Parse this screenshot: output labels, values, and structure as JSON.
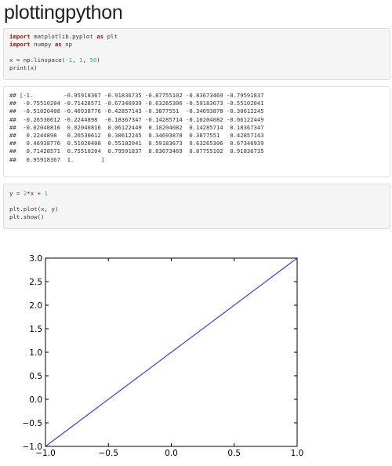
{
  "page": {
    "title": "plottingpython"
  },
  "cell1": {
    "code_lines": [
      [
        {
          "t": "import",
          "c": "kw"
        },
        {
          "t": " matplotlib.pyplot "
        },
        {
          "t": "as",
          "c": "kw"
        },
        {
          "t": " plt"
        }
      ],
      [
        {
          "t": "import",
          "c": "kw"
        },
        {
          "t": " numpy "
        },
        {
          "t": "as",
          "c": "kw"
        },
        {
          "t": " np"
        }
      ],
      [
        {
          "t": ""
        }
      ],
      [
        {
          "t": "x = np.linspace("
        },
        {
          "t": "-1",
          "c": "num"
        },
        {
          "t": ", "
        },
        {
          "t": "1",
          "c": "num"
        },
        {
          "t": ", "
        },
        {
          "t": "50",
          "c": "num"
        },
        {
          "t": ")"
        }
      ],
      [
        {
          "t": "print(x)"
        }
      ]
    ]
  },
  "output1": {
    "lines": [
      "## [-1.         -0.95918367 -0.91836735 -0.87755102 -0.83673469 -0.79591837",
      "##  -0.75510204 -0.71428571 -0.67346939 -0.63265306 -0.59183673 -0.55102041",
      "##  -0.51020408 -0.46938776 -0.42857143 -0.3877551  -0.34693878 -0.30612245",
      "##  -0.26530612 -0.2244898  -0.18367347 -0.14285714 -0.10204082 -0.06122449",
      "##  -0.02040816  0.02040816  0.06122449  0.10204082  0.14285714  0.18367347",
      "##   0.2244898   0.26530612  0.30612245  0.34693878  0.3877551   0.42857143",
      "##   0.46938776  0.51020408  0.55102041  0.59183673  0.63265306  0.67346939",
      "##   0.71428571  0.75510204  0.79591837  0.83673469  0.87755102  0.91836735",
      "##   0.95918367  1.        ]"
    ]
  },
  "cell2": {
    "code_lines": [
      [
        {
          "t": "y = "
        },
        {
          "t": "2",
          "c": "num"
        },
        {
          "t": "*x + "
        },
        {
          "t": "1",
          "c": "num"
        }
      ],
      [
        {
          "t": ""
        }
      ],
      [
        {
          "t": "plt.plot(x, y)"
        }
      ],
      [
        {
          "t": "plt.show()"
        }
      ]
    ]
  },
  "chart_data": {
    "type": "line",
    "title": "",
    "xlabel": "",
    "ylabel": "",
    "xlim": [
      -1.0,
      1.0
    ],
    "ylim": [
      -1.0,
      3.0
    ],
    "xticks": [
      "−1.0",
      "−0.5",
      "0.0",
      "0.5",
      "1.0"
    ],
    "xtick_values": [
      -1.0,
      -0.5,
      0.0,
      0.5,
      1.0
    ],
    "yticks": [
      "−1.0",
      "−0.5",
      "0.0",
      "0.5",
      "1.0",
      "1.5",
      "2.0",
      "2.5",
      "3.0"
    ],
    "ytick_values": [
      -1.0,
      -0.5,
      0.0,
      0.5,
      1.0,
      1.5,
      2.0,
      2.5,
      3.0
    ],
    "grid": false,
    "series": [
      {
        "color": "#3f3fe0",
        "x": [
          -1.0,
          1.0
        ],
        "y": [
          -1.0,
          3.0
        ]
      }
    ]
  }
}
